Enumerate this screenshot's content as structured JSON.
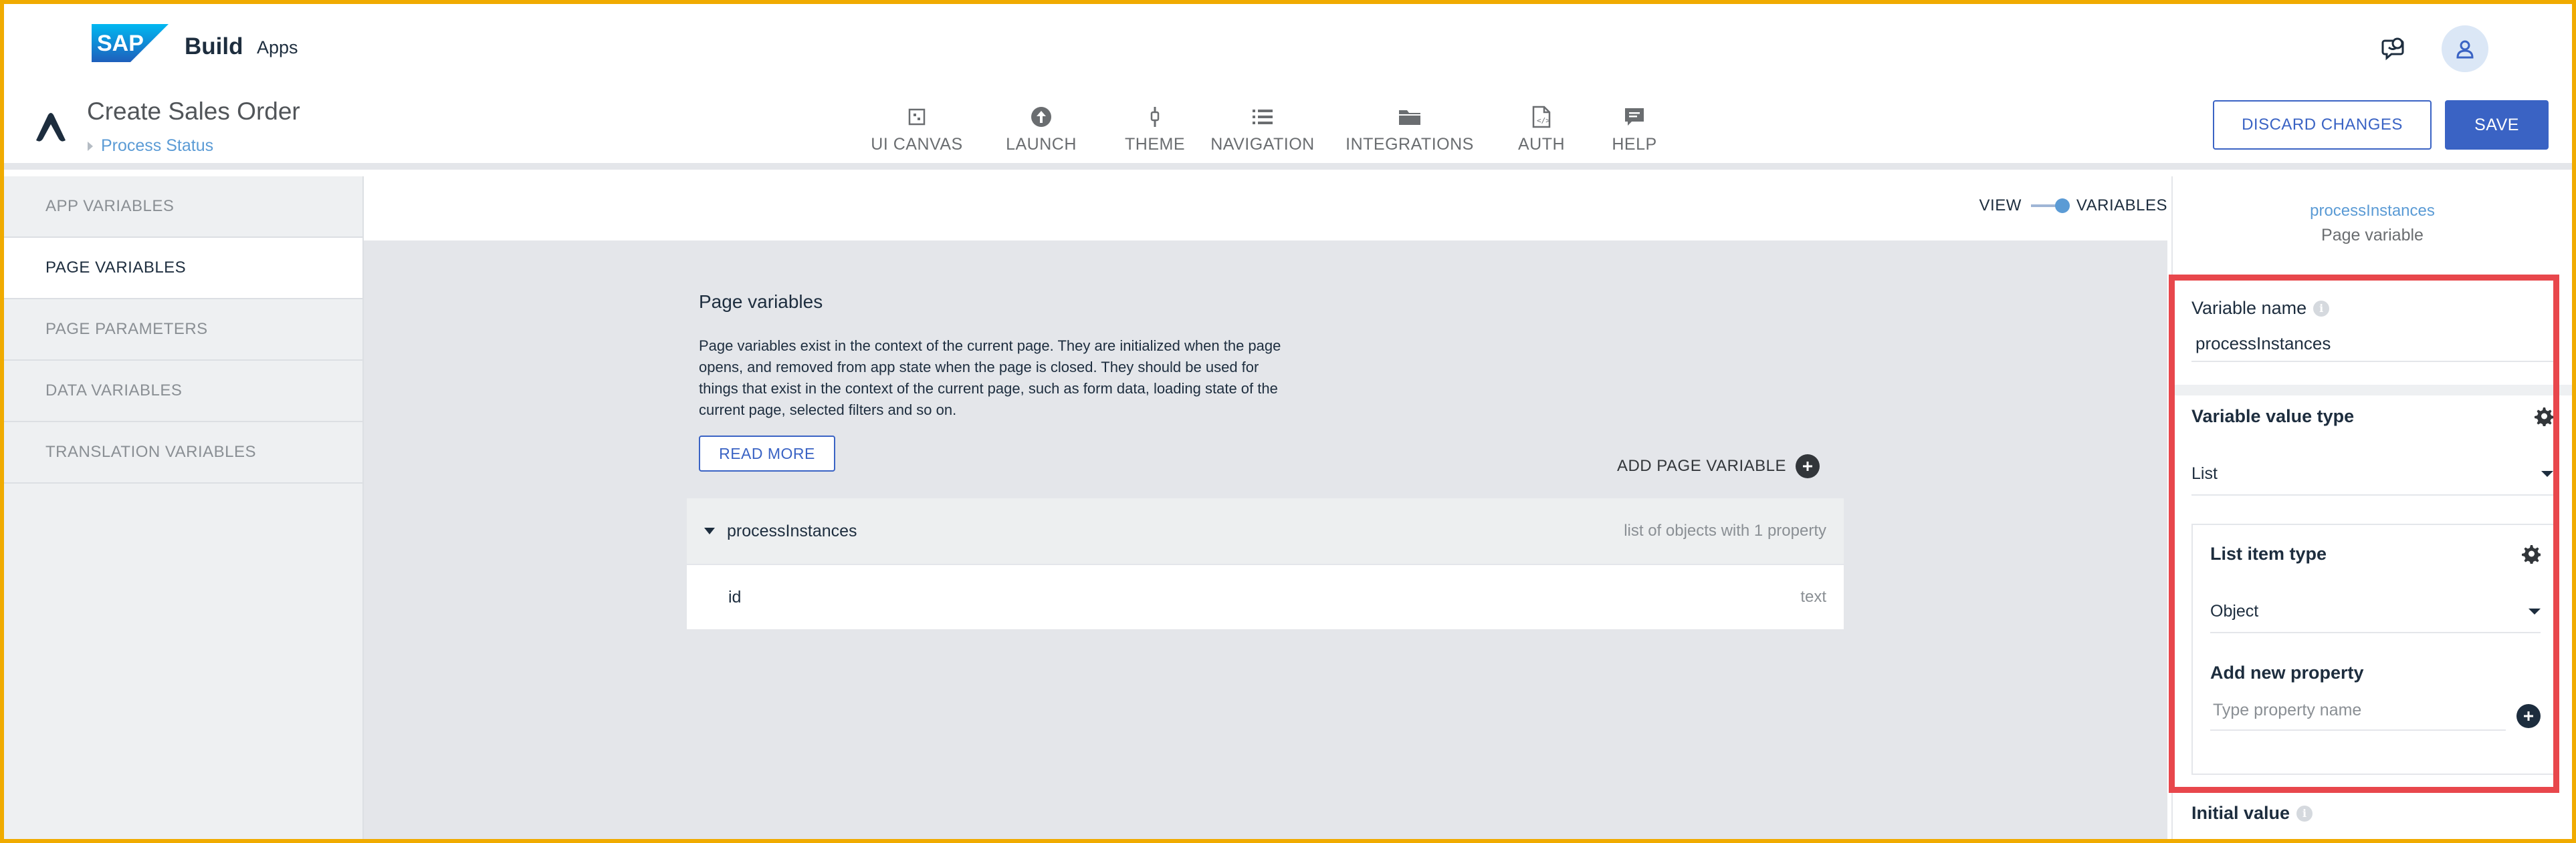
{
  "topbar": {
    "brand_logo_text": "SAP",
    "product": "Build",
    "product_sub": "Apps",
    "icons": [
      "feedback-icon",
      "user-avatar-icon"
    ]
  },
  "header": {
    "page_title": "Create Sales Order",
    "breadcrumb": "Process Status",
    "tabs": [
      {
        "label": "UI CANVAS",
        "icon": "canvas-icon"
      },
      {
        "label": "LAUNCH",
        "icon": "launch-icon"
      },
      {
        "label": "THEME",
        "icon": "theme-icon"
      },
      {
        "label": "NAVIGATION",
        "icon": "navigation-icon"
      },
      {
        "label": "INTEGRATIONS",
        "icon": "folder-icon"
      },
      {
        "label": "AUTH",
        "icon": "auth-icon"
      },
      {
        "label": "HELP",
        "icon": "help-chat-icon"
      }
    ],
    "discard_label": "DISCARD CHANGES",
    "save_label": "SAVE"
  },
  "sidebar": {
    "items": [
      {
        "label": "APP VARIABLES",
        "active": false
      },
      {
        "label": "PAGE VARIABLES",
        "active": true
      },
      {
        "label": "PAGE PARAMETERS",
        "active": false
      },
      {
        "label": "DATA VARIABLES",
        "active": false
      },
      {
        "label": "TRANSLATION VARIABLES",
        "active": false
      }
    ]
  },
  "view_toggle": {
    "left": "VIEW",
    "right": "VARIABLES",
    "selected": "VARIABLES"
  },
  "main": {
    "title": "Page variables",
    "description": "Page variables exist in the context of the current page. They are initialized when the page opens, and removed from app state when the page is closed. They should be used for things that exist in the context of the current page, such as form data, loading state of the current page, selected filters and so on.",
    "read_more": "READ MORE",
    "add_variable": "ADD PAGE VARIABLE",
    "variables": [
      {
        "name": "processInstances",
        "type": "list of objects with 1 property",
        "properties": [
          {
            "name": "id",
            "type": "text"
          }
        ]
      }
    ]
  },
  "panel": {
    "name": "processInstances",
    "subtitle": "Page variable",
    "variable_name_label": "Variable name",
    "variable_name_value": "processInstances",
    "value_type_label": "Variable value type",
    "value_type_value": "List",
    "list_item_type_label": "List item type",
    "list_item_type_value": "Object",
    "add_property_label": "Add new property",
    "add_property_placeholder": "Type property name",
    "initial_value_label": "Initial value"
  },
  "colors": {
    "accent": "#3a63c4",
    "link": "#5b9bd5",
    "highlight": "#e8474c",
    "window_border": "#f0ab00"
  }
}
